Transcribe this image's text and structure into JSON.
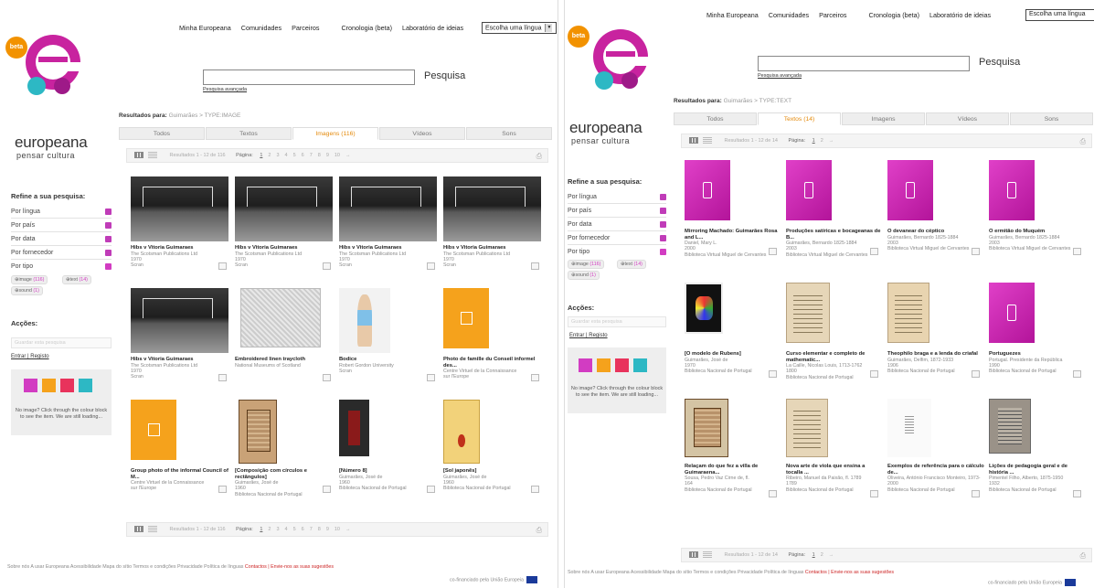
{
  "left": {
    "nav": [
      "Minha Europeana",
      "Comunidades",
      "Parceiros",
      "Cronologia (beta)",
      "Laboratório de ideias"
    ],
    "lang_label": "Escolha uma língua",
    "beta": "beta",
    "wordmark": "europeana",
    "tagline": "pensar cultura",
    "search_button": "Pesquisa",
    "advanced": "Pesquisa avançada",
    "results_label": "Resultados para:",
    "results_query": "Guimarães > TYPE:IMAGE",
    "tabs": [
      "Todos",
      "Textos",
      "Imagens (116)",
      "Vídeos",
      "Sons"
    ],
    "pager": {
      "range": "Resultados 1 - 12 de 116",
      "page_label": "Página:",
      "pages": [
        "1",
        "2",
        "3",
        "4",
        "5",
        "6",
        "7",
        "8",
        "9",
        "10",
        "→"
      ]
    },
    "refine_title": "Refine a sua pesquisa:",
    "facets": [
      "Por língua",
      "Por país",
      "Por data",
      "Por fornecedor",
      "Por tipo"
    ],
    "chips": [
      {
        "label": "image",
        "count": "(116)"
      },
      {
        "label": "text",
        "count": "(14)"
      },
      {
        "label": "sound",
        "count": "(1)"
      }
    ],
    "acoes": "Acções:",
    "save_query": "Guardar esta pesquisa",
    "login": "Entrar | Registo",
    "legend": "No image? Click through the colour block to see the item. We are still loading...",
    "items": [
      {
        "title": "Hibs v Vitoria Guimaraes",
        "l1": "The Scotsman Publications Ltd",
        "l2": "1970",
        "l3": "Scran"
      },
      {
        "title": "Hibs v Vitoria Guimaraes",
        "l1": "The Scotsman Publications Ltd",
        "l2": "1970",
        "l3": "Scran"
      },
      {
        "title": "Hibs v Vitoria Guimaraes",
        "l1": "The Scotsman Publications Ltd",
        "l2": "1970",
        "l3": "Scran"
      },
      {
        "title": "Hibs v Vitoria Guimaraes",
        "l1": "The Scotsman Publications Ltd",
        "l2": "1970",
        "l3": "Scran"
      },
      {
        "title": "Hibs v Vitoria Guimaraes",
        "l1": "The Scotsman Publications Ltd",
        "l2": "1970",
        "l3": "Scran"
      },
      {
        "title": "Embroidered linen traycloth",
        "l1": "National Museums of Scotland",
        "l2": "",
        "l3": ""
      },
      {
        "title": "Bodice",
        "l1": "Robert Gordon University",
        "l2": "",
        "l3": "Scran"
      },
      {
        "title": "Photo de famille du Conseil informel des...",
        "l1": "Centre Virtuel de la Connaissance",
        "l2": "sur l'Europe",
        "l3": ""
      },
      {
        "title": "Group photo of the informal Council of M...",
        "l1": "Centre Virtuel de la Connaissance",
        "l2": "sur l'Europe",
        "l3": ""
      },
      {
        "title": "[Composição com círculos e rectângulos]",
        "l1": "Guimarães, José de",
        "l2": "1960",
        "l3": "Biblioteca Nacional de Portugal"
      },
      {
        "title": "[Número 8]",
        "l1": "Guimarães, José de",
        "l2": "1960",
        "l3": "Biblioteca Nacional de Portugal"
      },
      {
        "title": "[Sol japonês]",
        "l1": "Guimarães, José de",
        "l2": "1960",
        "l3": "Biblioteca Nacional de Portugal"
      }
    ],
    "footer": "Sobre nós   A usar Europeana   Acessibilidade   Mapa do sítio   Termos e condições   Privacidade   Política de línguas",
    "footer_red": "Contactos | Envie-nos as suas sugestões",
    "cofin": "co-financiado pela União Europeia"
  },
  "right": {
    "nav": [
      "Minha Europeana",
      "Comunidades",
      "Parceiros",
      "Cronologia (beta)",
      "Laboratório de ideias"
    ],
    "lang_label": "Escolha uma língua",
    "beta": "beta",
    "wordmark": "europeana",
    "tagline": "pensar cultura",
    "search_button": "Pesquisa",
    "advanced": "Pesquisa avançada",
    "results_label": "Resultados para:",
    "results_query": "Guimarães > TYPE:TEXT",
    "tabs": [
      "Todos",
      "Textos (14)",
      "Imagens",
      "Vídeos",
      "Sons"
    ],
    "pager": {
      "range": "Resultados 1 - 12 de 14",
      "page_label": "Página:",
      "pages": [
        "1",
        "2",
        "→"
      ]
    },
    "refine_title": "Refine a sua pesquisa:",
    "facets": [
      "Por língua",
      "Por país",
      "Por data",
      "Por fornecedor",
      "Por tipo"
    ],
    "chips": [
      {
        "label": "image",
        "count": "(116)"
      },
      {
        "label": "text",
        "count": "(14)"
      },
      {
        "label": "sound",
        "count": "(1)"
      }
    ],
    "acoes": "Acções:",
    "save_query": "Guardar esta pesquisa",
    "login": "Entrar | Registo",
    "legend": "No image? Click through the colour block to see the item. We are still loading...",
    "items": [
      {
        "title": "Mirroring Machado: Guimarães Rosa and L...",
        "l1": "Daniel, Mary L.",
        "l2": "2000",
        "l3": "Biblioteca Virtual Miguel de Cervantes"
      },
      {
        "title": "Produções satíricas e bocageanas de B...",
        "l1": "Guimarães, Bernardo 1825-1884",
        "l2": "2003",
        "l3": "Biblioteca Virtual Miguel de Cervantes"
      },
      {
        "title": "O devanear do céptico",
        "l1": "Guimarães, Bernardo 1825-1884",
        "l2": "2003",
        "l3": "Biblioteca Virtual Miguel de Cervantes"
      },
      {
        "title": "O ermitão do Muquém",
        "l1": "Guimarães, Bernardo 1825-1884",
        "l2": "2003",
        "l3": "Biblioteca Virtual Miguel de Cervantes"
      },
      {
        "title": "[O modelo de Rubens]",
        "l1": "Guimarães, José de",
        "l2": "1970",
        "l3": "Biblioteca Nacional de Portugal"
      },
      {
        "title": "Curso elementar e completo de mathematic...",
        "l1": "La Caille, Nicolas Louis, 1713-1762",
        "l2": "1800",
        "l3": "Biblioteca Nacional de Portugal"
      },
      {
        "title": "Theophilo braga e a lenda do criafal",
        "l1": "Guimarães, Delfim, 1872-1933",
        "l2": "1906",
        "l3": "Biblioteca Nacional de Portugal"
      },
      {
        "title": "Portuguezes",
        "l1": "Portugal. Presidente da República",
        "l2": "1990",
        "l3": "Biblioteca Nacional de Portugal"
      },
      {
        "title": "Relaçam do que fez a villa de Guimaraena...",
        "l1": "Sousa, Pedro Vaz Cirne de, fl.",
        "l2": "164",
        "l3": "Biblioteca Nacional de Portugal"
      },
      {
        "title": "Nova arte de viola que ensina a tocalla ...",
        "l1": "Ribeiro, Manuel da Paixão, fl. 1789",
        "l2": "1789",
        "l3": "Biblioteca Nacional de Portugal"
      },
      {
        "title": "Exemplos de referência para o cálculo de...",
        "l1": "Oliveira, António Francisco Monteiro, 1973-",
        "l2": "2000",
        "l3": "Biblioteca Nacional de Portugal"
      },
      {
        "title": "Lições de pedagogia geral e de história ...",
        "l1": "Pimentel Filho, Alberto, 1875-1950",
        "l2": "1932",
        "l3": "Biblioteca Nacional de Portugal"
      }
    ],
    "footer": "Sobre nós   A usar Europeana   Acessibilidade   Mapa do sítio   Termos e condições   Privacidade   Política de línguas",
    "footer_red": "Contactos | Envie-nos as suas sugestões",
    "cofin": "co-financiado pela União Europeia"
  }
}
